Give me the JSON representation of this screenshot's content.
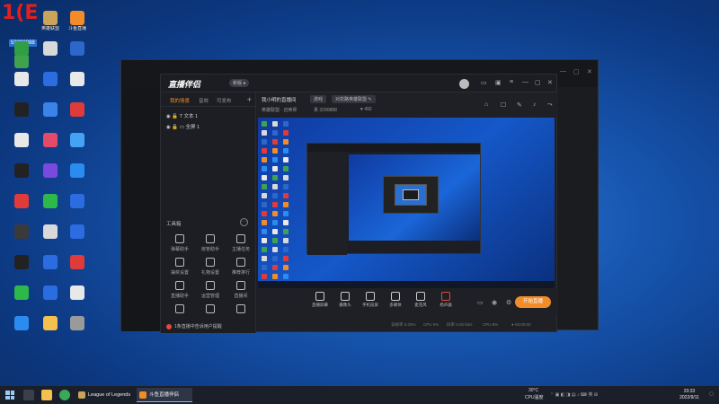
{
  "desktop": {
    "logo_text": "1(E",
    "logo_sub": "53290888",
    "icons": [
      {
        "label": "",
        "color": "#3fa34d"
      },
      {
        "label": "英雄联盟",
        "color": "#c9a45a"
      },
      {
        "label": "斗鱼直播",
        "color": "#f28c28"
      },
      {
        "label": "",
        "color": "#2f9e44"
      },
      {
        "label": "",
        "color": "#d9d9d9"
      },
      {
        "label": "",
        "color": "#2d67c9"
      },
      {
        "label": "",
        "color": "#e8e8e8"
      },
      {
        "label": "",
        "color": "#2b6ce0"
      },
      {
        "label": "",
        "color": "#e8e8e8"
      },
      {
        "label": "",
        "color": "#222222"
      },
      {
        "label": "",
        "color": "#3a83e8"
      },
      {
        "label": "",
        "color": "#e03b3b"
      },
      {
        "label": "",
        "color": "#e8e8e8"
      },
      {
        "label": "",
        "color": "#e34a6b"
      },
      {
        "label": "",
        "color": "#45a3f5"
      },
      {
        "label": "",
        "color": "#222222"
      },
      {
        "label": "",
        "color": "#7a4ae0"
      },
      {
        "label": "",
        "color": "#2b8cf0"
      },
      {
        "label": "",
        "color": "#e03b3b"
      },
      {
        "label": "",
        "color": "#2db84a"
      },
      {
        "label": "",
        "color": "#2b6ce0"
      },
      {
        "label": "",
        "color": "#3a3a3a"
      },
      {
        "label": "",
        "color": "#d9d9d9"
      },
      {
        "label": "",
        "color": "#2b6ce0"
      },
      {
        "label": "",
        "color": "#222222"
      },
      {
        "label": "",
        "color": "#2b6ce0"
      },
      {
        "label": "",
        "color": "#e03b3b"
      },
      {
        "label": "",
        "color": "#2db84a"
      },
      {
        "label": "",
        "color": "#2b6ce0"
      },
      {
        "label": "",
        "color": "#e8e8e8"
      },
      {
        "label": "",
        "color": "#2b8cf0"
      },
      {
        "label": "",
        "color": "#f2c14e"
      },
      {
        "label": "",
        "color": "#9a9a9a"
      }
    ]
  },
  "app": {
    "title": "直播伴侣",
    "version_badge": "新版 ●",
    "tabs": [
      "我的场景",
      "音效",
      "可发布"
    ],
    "scenes": [
      "文本 1",
      "全屏 1"
    ],
    "tools_header": "工具箱",
    "tools": [
      {
        "label": "弹幕助手"
      },
      {
        "label": "房管助手"
      },
      {
        "label": "主播任务"
      },
      {
        "label": "抽奖设置"
      },
      {
        "label": "礼物设置"
      },
      {
        "label": "推荐排行"
      },
      {
        "label": "直播助手"
      },
      {
        "label": "运营管理"
      },
      {
        "label": "直播间"
      },
      {
        "label": ""
      },
      {
        "label": ""
      },
      {
        "label": ""
      }
    ],
    "notice": "1条直播中告诉用户提醒",
    "info": {
      "title": "我小明的直播间",
      "chips": [
        "游戏",
        "对抗路英雄联盟 ✎"
      ],
      "line2_a": "英雄联盟 · 召唤师",
      "line2_b": "贡 3290888",
      "line2_c": "♥ 492"
    },
    "controls": [
      {
        "label": "直播屏幕"
      },
      {
        "label": "摄像头"
      },
      {
        "label": "手机投屏"
      },
      {
        "label": "多媒体"
      },
      {
        "label": "麦克风"
      },
      {
        "label": "扬声器"
      }
    ],
    "start_button": "开始直播",
    "status": {
      "a": "丢帧率 0.00%",
      "b": "CPU 0%",
      "c": "码率 0.00 kb/s",
      "d": "CPU 9%",
      "e": "● 00:00:00"
    }
  },
  "outer": {
    "title": "League of Legends"
  },
  "taskbar": {
    "items": [
      {
        "label": "League of Legends",
        "active": false,
        "color": "#c9a45a"
      },
      {
        "label": "斗鱼直播伴侣",
        "active": true,
        "color": "#f28c28"
      }
    ],
    "weather": "30°C",
    "weather_sub": "CPU温度",
    "time": "20:33",
    "date": "2022/9/11"
  },
  "colors": {
    "accent": "#f28c28",
    "app_bg": "#1e2026",
    "desktop": "#1756b0"
  }
}
